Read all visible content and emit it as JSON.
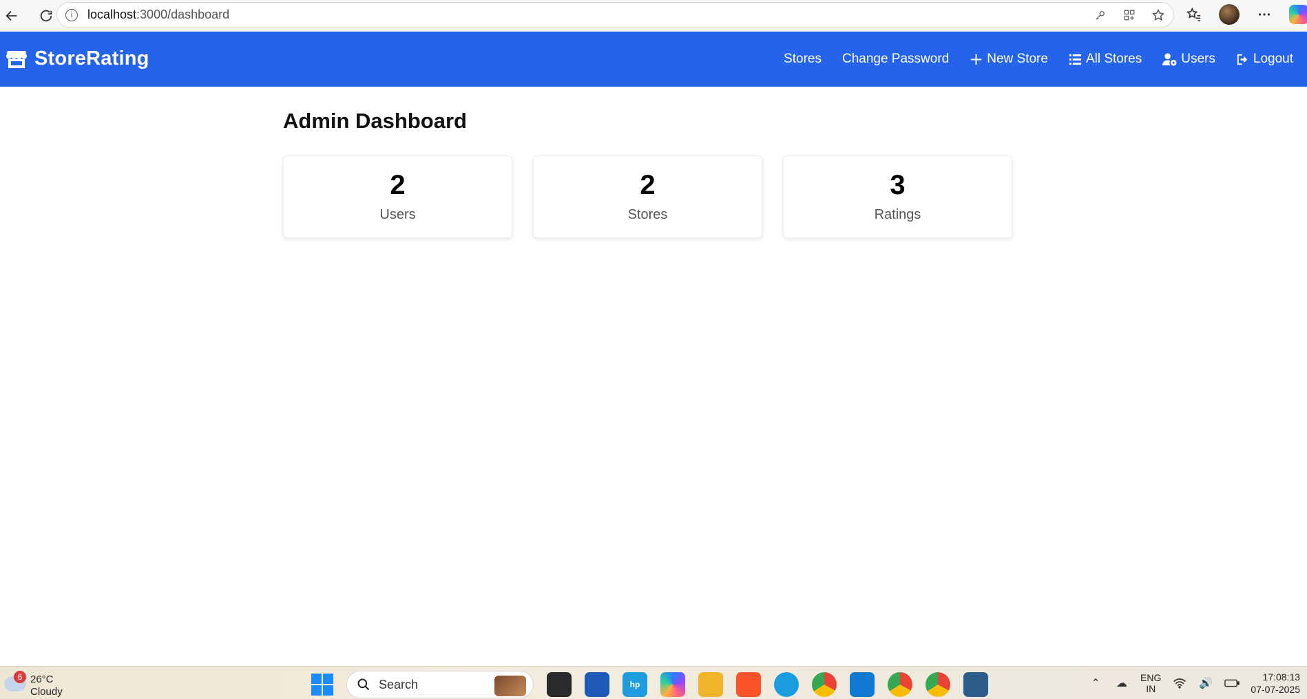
{
  "browser": {
    "url_host": "localhost",
    "url_path": ":3000/dashboard"
  },
  "app": {
    "brand": "StoreRating",
    "nav": [
      {
        "label": "Stores",
        "icon": "none"
      },
      {
        "label": "Change Password",
        "icon": "none"
      },
      {
        "label": "New Store",
        "icon": "plus-icon"
      },
      {
        "label": "All Stores",
        "icon": "list-icon"
      },
      {
        "label": "Users",
        "icon": "user-gear-icon"
      },
      {
        "label": "Logout",
        "icon": "logout-icon"
      }
    ],
    "brand_color": "#2563eb"
  },
  "main": {
    "title": "Admin Dashboard",
    "cards": [
      {
        "value": "2",
        "label": "Users"
      },
      {
        "value": "2",
        "label": "Stores"
      },
      {
        "value": "3",
        "label": "Ratings"
      }
    ]
  },
  "taskbar": {
    "weather_badge": "6",
    "temperature": "26°C",
    "condition": "Cloudy",
    "search_label": "Search",
    "lang_1": "ENG",
    "lang_2": "IN",
    "time": "17:08:13",
    "date": "07-07-2025"
  }
}
